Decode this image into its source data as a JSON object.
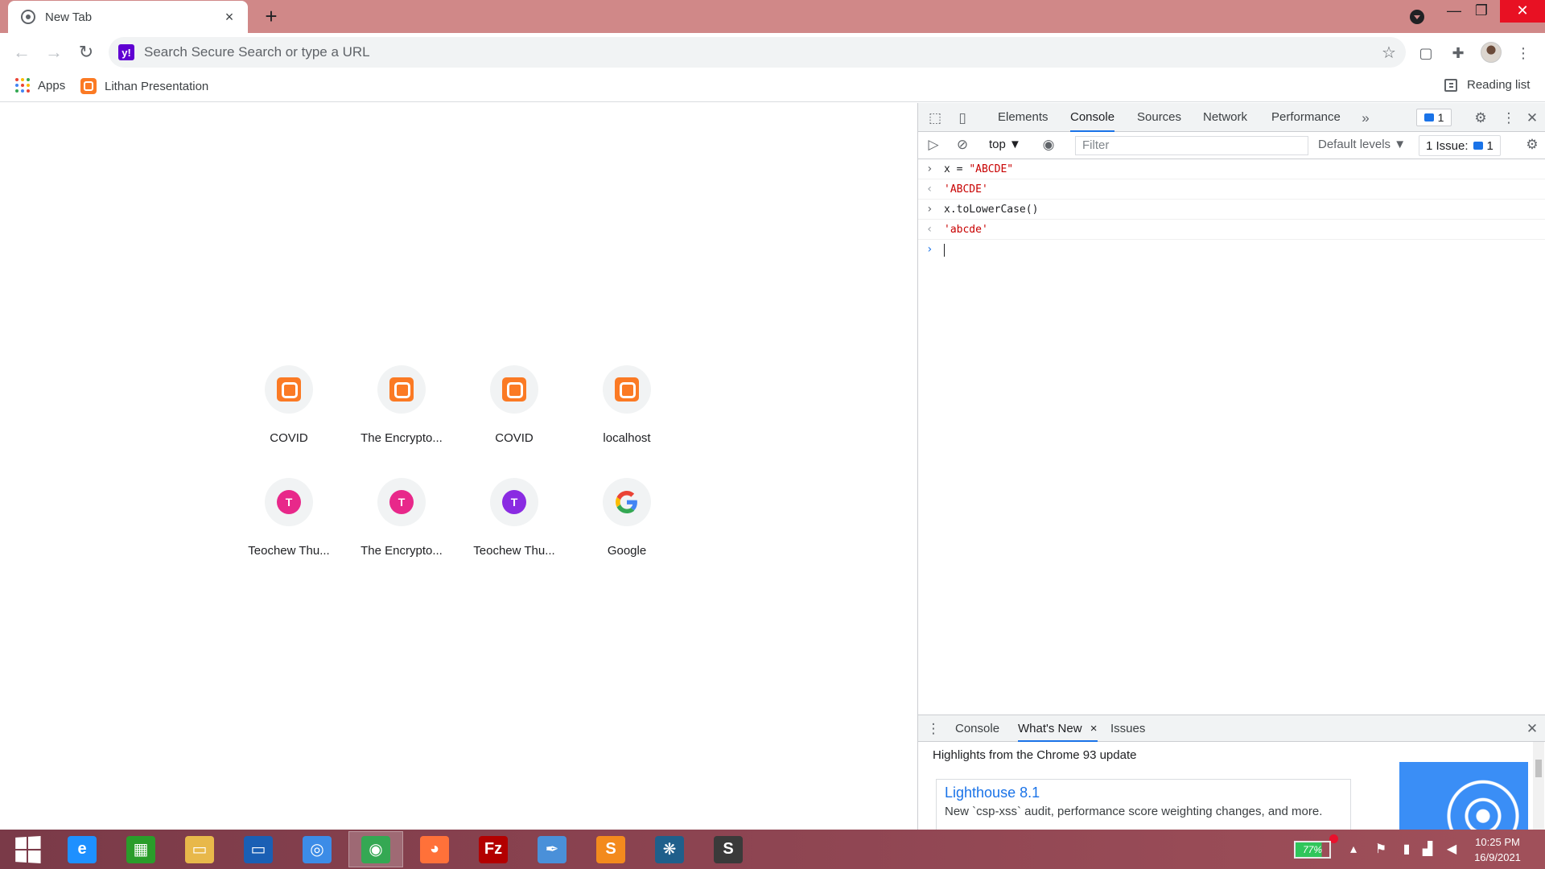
{
  "browser": {
    "tab": {
      "title": "New Tab",
      "close": "×"
    },
    "new_tab": "+",
    "window": {
      "minimize": "—",
      "restore": "❐",
      "close": "✕"
    }
  },
  "toolbar": {
    "back": "←",
    "forward": "→",
    "reload": "↻",
    "search_engine_icon": "y!",
    "omnibox_placeholder": "Search Secure Search or type a URL",
    "bookmark_star": "☆",
    "menu": "⋮"
  },
  "bookmarks": {
    "apps_label": "Apps",
    "items": [
      {
        "label": "Lithan Presentation"
      }
    ],
    "reading_list_label": "Reading list",
    "apps_colors": [
      "#ea4335",
      "#fbbc05",
      "#34a853",
      "#4285f4",
      "#ea4335",
      "#fbbc05",
      "#34a853",
      "#4285f4",
      "#ea4335"
    ]
  },
  "ntp": {
    "shortcuts": [
      {
        "label": "COVID",
        "icon": "xampp-icon"
      },
      {
        "label": "The Encrypto...",
        "icon": "xampp-icon"
      },
      {
        "label": "COVID",
        "icon": "xampp-icon"
      },
      {
        "label": "localhost",
        "icon": "xampp-icon"
      },
      {
        "label": "Teochew Thu...",
        "icon": "letter-icon",
        "letter": "T",
        "color": "#e8288a"
      },
      {
        "label": "The Encrypto...",
        "icon": "letter-icon",
        "letter": "T",
        "color": "#e8288a"
      },
      {
        "label": "Teochew Thu...",
        "icon": "letter-icon",
        "letter": "T",
        "color": "#8a2be2"
      },
      {
        "label": "Google",
        "icon": "google-icon",
        "letter": "G"
      }
    ]
  },
  "devtools": {
    "tabs": [
      "Elements",
      "Console",
      "Sources",
      "Network",
      "Performance"
    ],
    "active_tab": "Console",
    "more_tabs": "»",
    "issues_badge": "1",
    "context": "top ▼",
    "filter_placeholder": "Filter",
    "levels": "Default levels ▼",
    "issues_count_label": "1 Issue:",
    "issues_count": "1",
    "console_lines": [
      {
        "type": "input",
        "code": "x = ",
        "string": "\"ABCDE\""
      },
      {
        "type": "output",
        "string": "'ABCDE'"
      },
      {
        "type": "input",
        "code": "x.toLowerCase()",
        "string": ""
      },
      {
        "type": "output",
        "string": "'abcde'"
      }
    ],
    "drawer": {
      "tabs": [
        "Console",
        "What's New",
        "Issues"
      ],
      "active_tab": "What's New",
      "close_tab": "×",
      "close_drawer": "✕",
      "highlights": "Highlights from the Chrome 93 update",
      "card_title": "Lighthouse 8.1",
      "card_desc": "New `csp-xss` audit, performance score weighting changes, and more."
    }
  },
  "taskbar": {
    "battery": "77%",
    "time": "10:25 PM",
    "date": "16/9/2021",
    "apps": [
      {
        "name": "internet-explorer",
        "glyph": "e",
        "color": "#1e90ff"
      },
      {
        "name": "store",
        "glyph": "▦",
        "color": "#2a9d2a"
      },
      {
        "name": "file-explorer",
        "glyph": "▭",
        "color": "#e8b84a"
      },
      {
        "name": "lenovo",
        "glyph": "▭",
        "color": "#1a5fb4"
      },
      {
        "name": "safari",
        "glyph": "◎",
        "color": "#3c8ce7"
      },
      {
        "name": "chrome",
        "glyph": "◉",
        "color": "#34a853"
      },
      {
        "name": "firefox",
        "glyph": "◕",
        "color": "#ff7139"
      },
      {
        "name": "filezilla",
        "glyph": "Fz",
        "color": "#b30000"
      },
      {
        "name": "pen-app",
        "glyph": "✒",
        "color": "#4a90d9"
      },
      {
        "name": "sublime",
        "glyph": "S",
        "color": "#f38a1d"
      },
      {
        "name": "tree-app",
        "glyph": "❋",
        "color": "#1f5f8b"
      },
      {
        "name": "sublime-active",
        "glyph": "S",
        "color": "#3a3a3a"
      }
    ],
    "active_app": "chrome"
  }
}
